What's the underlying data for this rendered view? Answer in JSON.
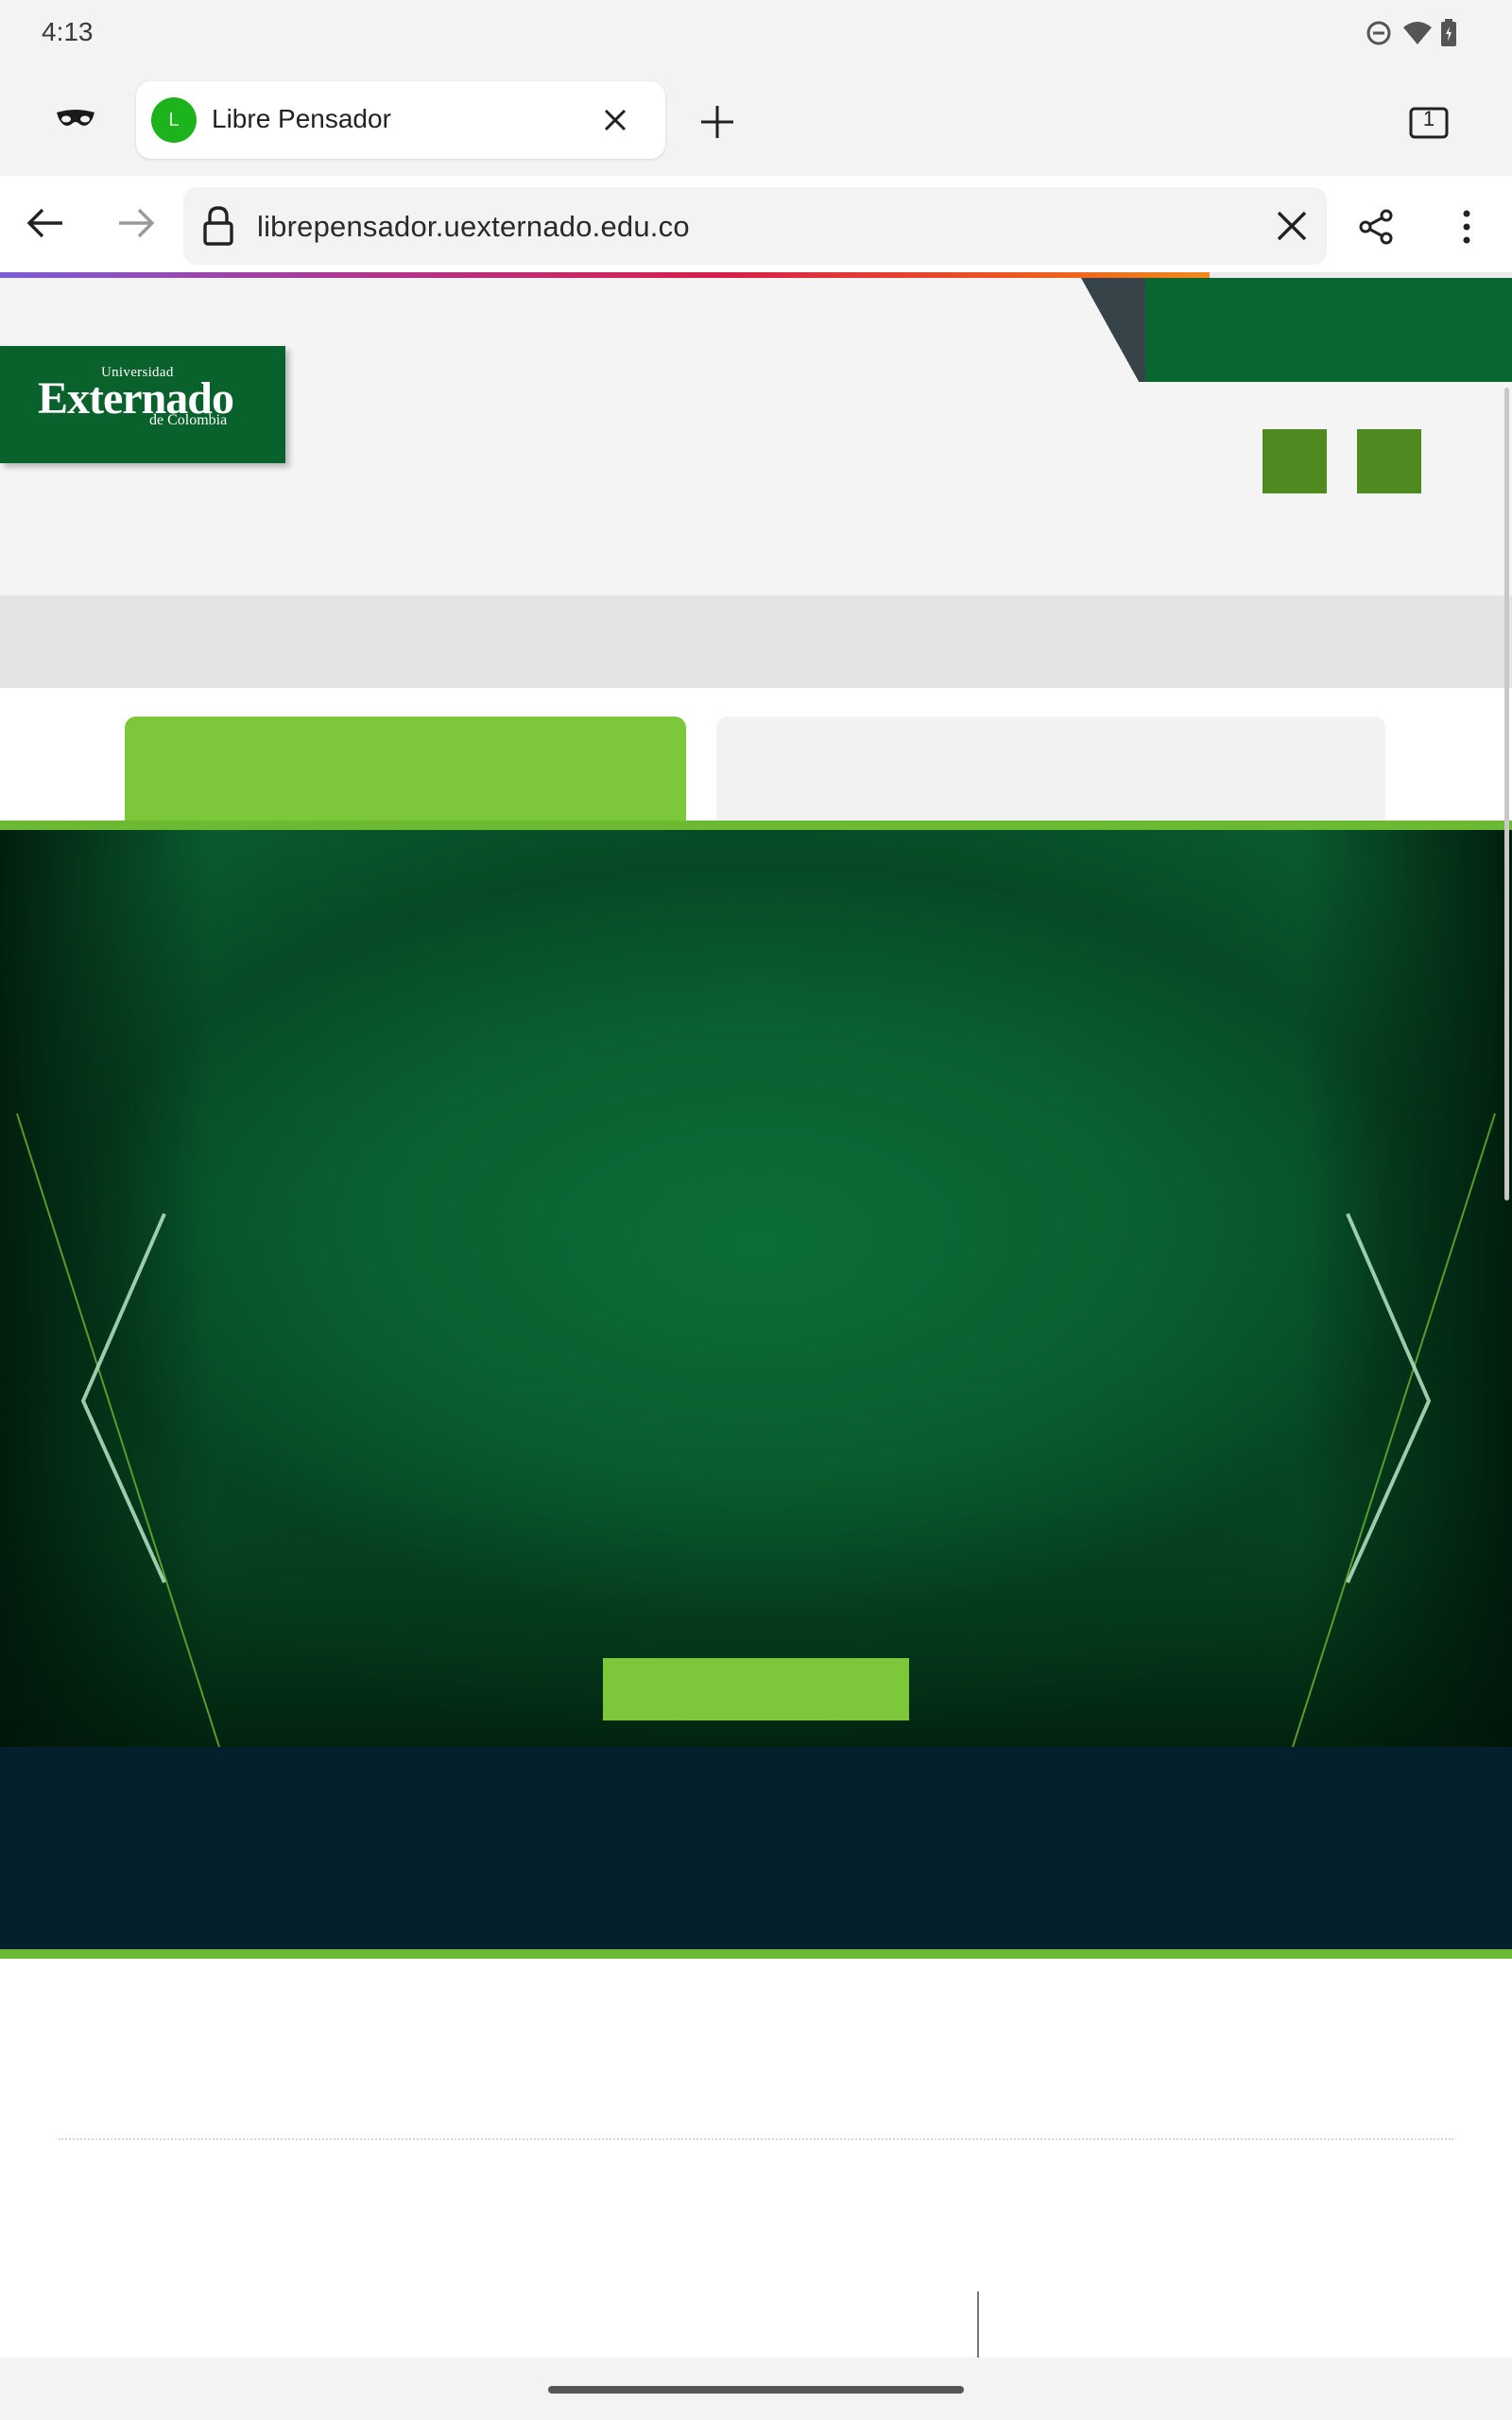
{
  "status_bar": {
    "time": "4:13",
    "icons": [
      "do-not-disturb-icon",
      "wifi-icon",
      "battery-icon"
    ]
  },
  "tabs": {
    "active_tab": {
      "favicon_letter": "L",
      "title": "Libre Pensador"
    },
    "tab_count": "1",
    "icons": [
      "incognito-icon",
      "close-icon",
      "plus-icon",
      "tab-switcher-icon"
    ]
  },
  "toolbar": {
    "url": "librepensador.uexternado.edu.co",
    "load_progress": 0.8,
    "icons": [
      "back-arrow-icon",
      "forward-arrow-icon",
      "lock-icon",
      "clear-icon",
      "share-icon",
      "more-vert-icon"
    ]
  },
  "page": {
    "logo": {
      "line1": "Universidad",
      "line2": "Externado",
      "line3": "de Colombia"
    },
    "colors": {
      "brand_green": "#09612b",
      "accent_green": "#7dc83a",
      "dark_band": "#03202c"
    },
    "hero_icons": [
      "chevron-left-icon",
      "chevron-right-icon"
    ]
  }
}
